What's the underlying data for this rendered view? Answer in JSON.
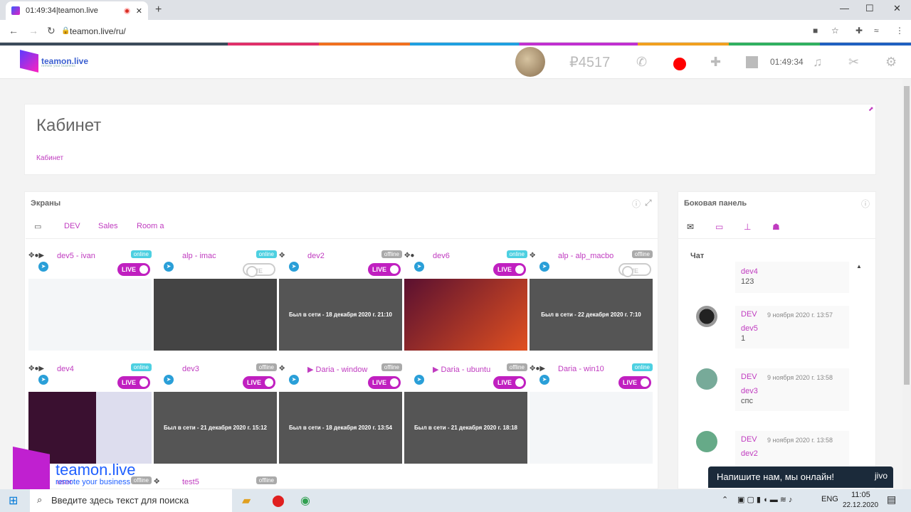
{
  "browser": {
    "tab_title": "01:49:34|teamon.live",
    "url": "teamon.live/ru/",
    "new_tab": "+",
    "close_tab": "✕",
    "minimize": "—",
    "maximize": "☐",
    "close": "✕"
  },
  "topbar": {
    "logo_text": "teamon.live",
    "logo_sub": "remote your business",
    "balance": "₽4517",
    "timer": "01:49:34"
  },
  "page": {
    "title": "Кабинет",
    "breadcrumb": "Кабинет"
  },
  "screens": {
    "heading": "Экраны",
    "tabs": [
      "DEV",
      "Sales",
      "Room a"
    ],
    "live_label": "LIVE",
    "items": [
      {
        "name": "dev5 - ivan",
        "ctl": "✥●▶",
        "status": "online",
        "live": true,
        "thumb": "",
        "style": "white"
      },
      {
        "name": "alp - imac",
        "ctl": "",
        "status": "online",
        "live": false,
        "thumb": "",
        "style": "dark"
      },
      {
        "name": "dev2",
        "ctl": "✥",
        "status": "offline",
        "live": true,
        "thumb": "Был в сети - 18 декабря 2020 г. 21:10",
        "style": ""
      },
      {
        "name": "dev6",
        "ctl": "✥●",
        "status": "online",
        "live": true,
        "thumb": "",
        "style": "ubuntu"
      },
      {
        "name": "alp - alp_macbo",
        "ctl": "✥",
        "status": "offline",
        "live": false,
        "thumb": "Был в сети - 22 декабря 2020 г. 7:10",
        "style": ""
      },
      {
        "name": "dev4",
        "ctl": "✥●▶",
        "status": "online",
        "live": true,
        "thumb": "",
        "style": "term"
      },
      {
        "name": "dev3",
        "ctl": "",
        "status": "offline",
        "live": true,
        "thumb": "Был в сети - 21 декабря 2020 г. 15:12",
        "style": ""
      },
      {
        "name": "▶ Daria - window",
        "ctl": "✥",
        "status": "offline",
        "live": true,
        "thumb": "Был в сети - 18 декабря 2020 г. 13:54",
        "style": ""
      },
      {
        "name": "▶ Daria - ubuntu",
        "ctl": "",
        "status": "offline",
        "live": true,
        "thumb": "Был в сети - 21 декабря 2020 г. 18:18",
        "style": ""
      },
      {
        "name": "Daria - win10",
        "ctl": "✥●▶",
        "status": "online",
        "live": true,
        "thumb": "",
        "style": "white"
      },
      {
        "name": "user",
        "ctl": "",
        "status": "offline",
        "live": false,
        "thumb": "",
        "style": "none"
      },
      {
        "name": "test5",
        "ctl": "✥",
        "status": "offline",
        "live": false,
        "thumb": "",
        "style": "none"
      }
    ]
  },
  "sidebar": {
    "heading": "Боковая панель",
    "chat_label": "Чат",
    "messages": [
      {
        "author": "",
        "date": "",
        "recipient": "dev4",
        "text": "123"
      },
      {
        "author": "DEV",
        "date": "9 ноября 2020 г. 13:57",
        "recipient": "dev5",
        "text": "1"
      },
      {
        "author": "DEV",
        "date": "9 ноября 2020 г. 13:58",
        "recipient": "dev3",
        "text": "спс"
      },
      {
        "author": "DEV",
        "date": "9 ноября 2020 г. 13:58",
        "recipient": "dev2",
        "text": ""
      }
    ]
  },
  "jivo": {
    "text": "Напишите нам, мы онлайн!",
    "brand": "jivo"
  },
  "watermark": {
    "title": "teamon.live",
    "subtitle": "remote your business"
  },
  "taskbar": {
    "search_placeholder": "Введите здесь текст для поиска",
    "lang": "ENG",
    "time": "11:05",
    "date": "22.12.2020"
  },
  "colors": {
    "accent": "#c03cc0",
    "online": "#4dd0e1",
    "record": "#ff0000"
  }
}
